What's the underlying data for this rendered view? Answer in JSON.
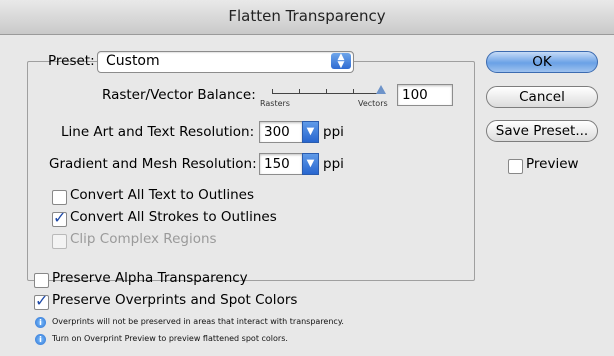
{
  "window": {
    "title": "Flatten Transparency"
  },
  "preset": {
    "label": "Preset:",
    "value": "Custom"
  },
  "balance": {
    "label": "Raster/Vector Balance:",
    "min_label": "Rasters",
    "max_label": "Vectors",
    "value": "100"
  },
  "line_art": {
    "label": "Line Art and Text Resolution:",
    "value": "300",
    "unit": "ppi"
  },
  "gradient": {
    "label": "Gradient and Mesh Resolution:",
    "value": "150",
    "unit": "ppi"
  },
  "options": [
    {
      "label": "Convert All Text to Outlines",
      "checked": false,
      "enabled": true
    },
    {
      "label": "Convert All Strokes to Outlines",
      "checked": true,
      "enabled": true
    },
    {
      "label": "Clip Complex Regions",
      "checked": false,
      "enabled": false
    }
  ],
  "preserve": [
    {
      "label": "Preserve Alpha Transparency",
      "checked": false
    },
    {
      "label": "Preserve Overprints and Spot Colors",
      "checked": true
    }
  ],
  "notes": [
    "Overprints will not be preserved in areas that interact with transparency.",
    "Turn on Overprint Preview to preview flattened spot colors."
  ],
  "buttons": {
    "ok": "OK",
    "cancel": "Cancel",
    "save_preset": "Save Preset...",
    "preview": "Preview"
  },
  "colors": {
    "accent": "#3d79d6",
    "dialog_bg": "#e8e8e8",
    "desktop": "#a9c4dc"
  },
  "icons": {
    "info": "info-icon",
    "dropdown": "chevron-updown-icon"
  }
}
